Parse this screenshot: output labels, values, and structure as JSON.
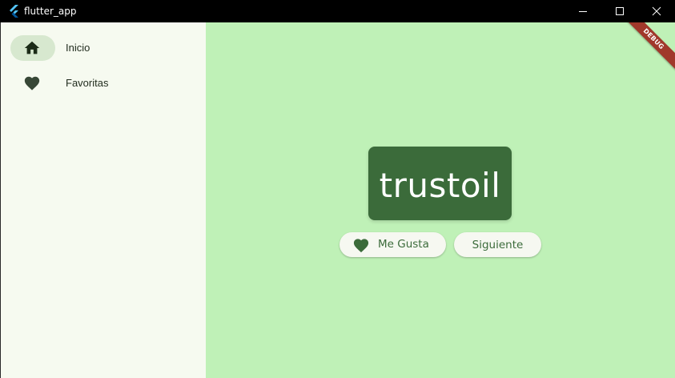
{
  "window": {
    "title": "flutter_app",
    "app_icon": "flutter-icon",
    "controls": [
      "minimize-icon",
      "maximize-icon",
      "close-icon"
    ]
  },
  "sidebar": {
    "items": [
      {
        "label": "Inicio",
        "icon": "home-icon",
        "selected": true
      },
      {
        "label": "Favoritas",
        "icon": "heart-icon",
        "selected": false
      }
    ]
  },
  "main": {
    "word": "trustoil",
    "like_button": {
      "label": "Me Gusta",
      "icon": "heart-icon"
    },
    "next_button": {
      "label": "Siguiente"
    },
    "debug_banner": "DEBUG"
  },
  "colors": {
    "titlebar": "#000000",
    "sidebar_bg": "#f6faf0",
    "nav_indicator": "#d7e8cf",
    "main_bg": "#bff1b7",
    "card_bg": "#3b6b3a",
    "button_bg": "#f6f8f1",
    "accent": "#3b6b3a",
    "debug_banner": "#a0382b"
  }
}
